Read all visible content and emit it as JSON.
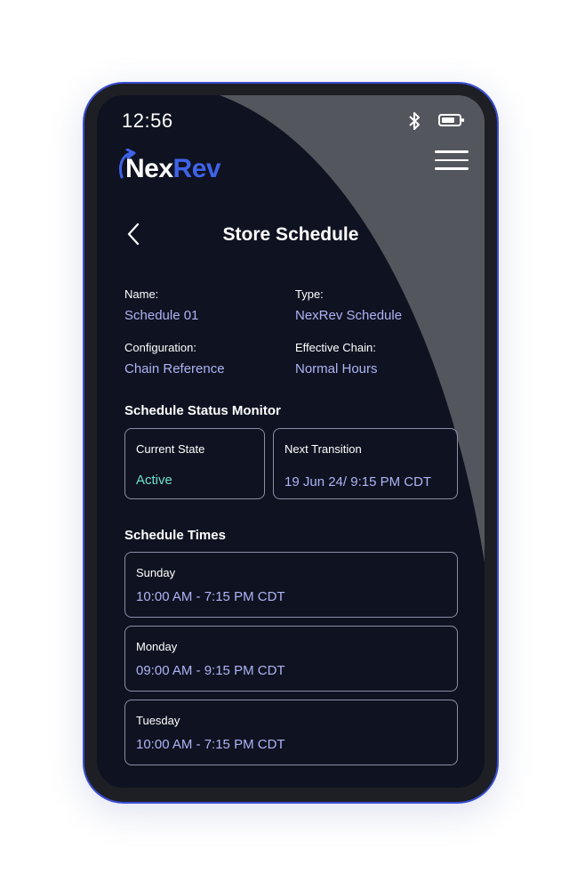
{
  "status_bar": {
    "time": "12:56",
    "bluetooth_icon": "bluetooth-icon",
    "battery_icon": "battery-icon"
  },
  "brand": {
    "logo_part1": "Nex",
    "logo_part2": "Rev",
    "accent": "#3f63e8"
  },
  "header": {
    "back_icon": "chevron-left-icon",
    "title": "Store Schedule",
    "menu_icon": "hamburger-menu-icon"
  },
  "details": {
    "name_label": "Name:",
    "name_value": "Schedule 01",
    "type_label": "Type:",
    "type_value": "NexRev Schedule",
    "config_label": "Configuration:",
    "config_value": "Chain Reference",
    "chain_label": "Effective Chain:",
    "chain_value": "Normal Hours"
  },
  "status_monitor": {
    "heading": "Schedule Status Monitor",
    "current_state_label": "Current State",
    "current_state_value": "Active",
    "next_transition_label": "Next Transition",
    "next_transition_value": "19 Jun 24/ 9:15 PM CDT"
  },
  "schedule_times": {
    "heading": "Schedule Times",
    "days": [
      {
        "day": "Sunday",
        "hours": "10:00 AM - 7:15 PM CDT"
      },
      {
        "day": "Monday",
        "hours": "09:00 AM - 9:15 PM CDT"
      },
      {
        "day": "Tuesday",
        "hours": "10:00 AM - 7:15 PM CDT"
      }
    ]
  }
}
